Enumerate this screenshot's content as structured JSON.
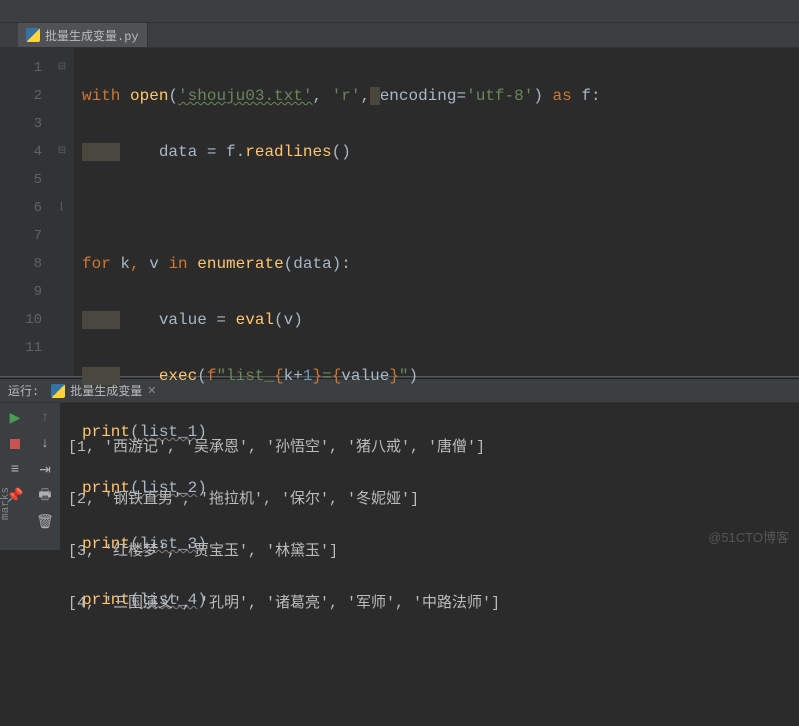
{
  "tab": {
    "filename": "批量生成变量.py"
  },
  "gutter": [
    "1",
    "2",
    "3",
    "4",
    "5",
    "6",
    "7",
    "8",
    "9",
    "10",
    "11"
  ],
  "code": {
    "l1": {
      "kw1": "with",
      "fn": "open",
      "s1": "'shouju03.txt'",
      "c1": ", ",
      "s2": "'r'",
      "c2": ",",
      "kv": "encoding=",
      "s3": "'utf-8'",
      "p2": ") ",
      "kw2": "as",
      "v": " f:"
    },
    "l2": {
      "txt1": "    data = f.",
      "fn": "readlines",
      "p": "()"
    },
    "l4": {
      "kw1": "for",
      "t1": " k",
      "c1": ",",
      "t2": " v ",
      "kw2": "in",
      "sp": " ",
      "fn": "enumerate",
      "t3": "(data):"
    },
    "l5": {
      "t1": "    value = ",
      "fn": "eval",
      "t2": "(v)"
    },
    "l6": {
      "t1": "    ",
      "fn": "exec",
      "p1": "(",
      "fp": "f",
      "s1": "\"list_",
      "b1": "{",
      "e1": "k+",
      "n1": "1",
      "b2": "}",
      "s2": "=",
      "b3": "{",
      "e2": "value",
      "b4": "}",
      "s3": "\"",
      "p2": ")"
    },
    "l7": {
      "fn": "print",
      "p1": "(",
      "v": "list_1",
      "p2": ")"
    },
    "l8": {
      "fn": "print",
      "p1": "(",
      "v": "list_2",
      "p2": ")"
    },
    "l9": {
      "fn": "print",
      "p1": "(",
      "v": "list_3",
      "p2": ")"
    },
    "l10": {
      "fn": "print",
      "p1": "(",
      "v": "list_4",
      "p2": ")"
    }
  },
  "run": {
    "label": "运行:",
    "name": "批量生成变量"
  },
  "output": {
    "l1": "[1, '西游记', '吴承恩', '孙悟空', '猪八戒', '唐僧']",
    "l2": "[2, '钢铁直男', '拖拉机', '保尔', '冬妮娅']",
    "l3": "[3, '红楼梦', '贾宝玉', '林黛玉']",
    "l4": "[4, '三国演义', '孔明', '诸葛亮', '军师', '中路法师']"
  },
  "watermark": "@51CTO博客",
  "sidetab": "marks"
}
